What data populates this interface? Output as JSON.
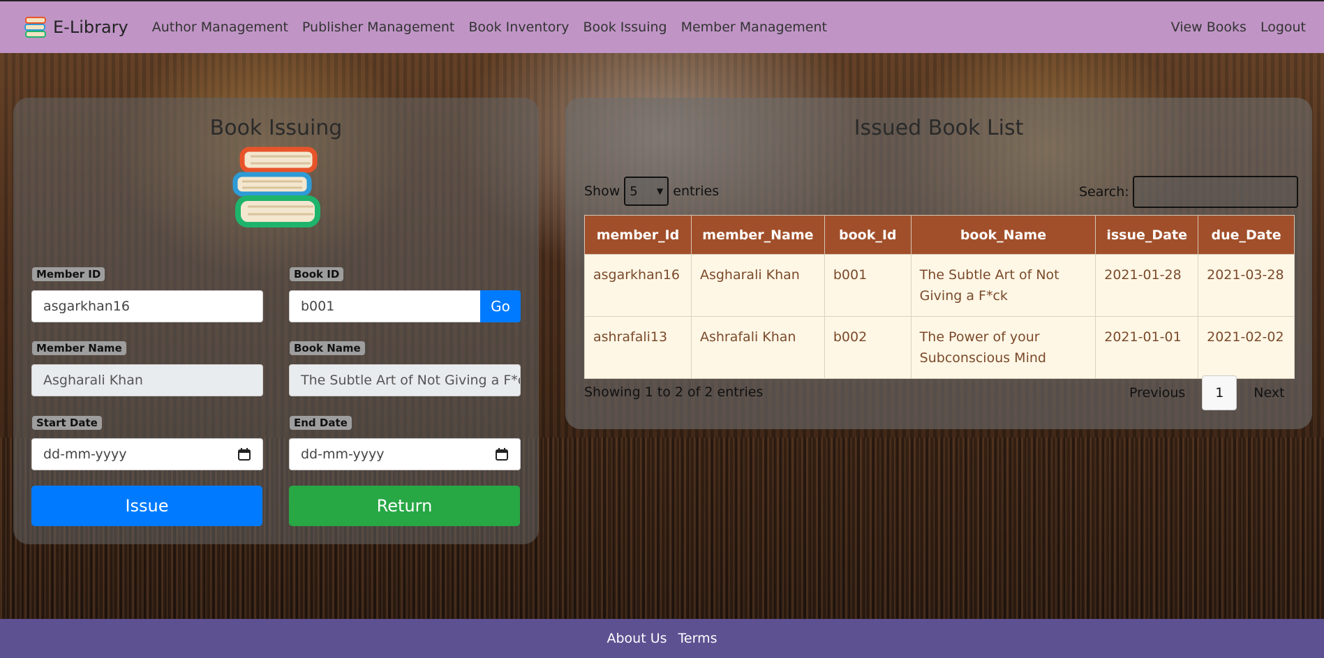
{
  "brand": {
    "name": "E-Library",
    "icon": "books-icon"
  },
  "nav": {
    "links": [
      "Author Management",
      "Publisher Management",
      "Book Inventory",
      "Book Issuing",
      "Member Management"
    ],
    "right": [
      "View Books",
      "Logout"
    ]
  },
  "issue_form": {
    "title": "Book Issuing",
    "member_id_label": "Member ID",
    "member_id_value": "asgarkhan16",
    "book_id_label": "Book ID",
    "book_id_value": "b001",
    "go_label": "Go",
    "member_name_label": "Member Name",
    "member_name_value": "Asgharali Khan",
    "book_name_label": "Book Name",
    "book_name_value": "The Subtle Art of Not Giving a F*c",
    "start_date_label": "Start Date",
    "start_date_placeholder": "dd-mm-yyyy",
    "end_date_label": "End Date",
    "end_date_placeholder": "dd-mm-yyyy",
    "issue_label": "Issue",
    "return_label": "Return"
  },
  "issued_list": {
    "title": "Issued Book List",
    "show_label": "Show",
    "page_size": "5",
    "entries_label": "entries",
    "search_label": "Search:",
    "columns": [
      "member_Id",
      "member_Name",
      "book_Id",
      "book_Name",
      "issue_Date",
      "due_Date"
    ],
    "rows": [
      [
        "asgarkhan16",
        "Asgharali Khan",
        "b001",
        "The Subtle Art of Not Giving a F*ck",
        "2021-01-28",
        "2021-03-28"
      ],
      [
        "ashrafali13",
        "Ashrafali Khan",
        "b002",
        "The Power of your Subconscious Mind",
        "2021-01-01",
        "2021-02-02"
      ]
    ],
    "info": "Showing 1 to 2 of 2 entries",
    "previous_label": "Previous",
    "current_page": "1",
    "next_label": "Next"
  },
  "footer": {
    "links": [
      "About Us",
      "Terms"
    ]
  },
  "colors": {
    "navbar": "#c095c6",
    "footer": "#5d5191",
    "primary": "#007bff",
    "success": "#28a745",
    "table_header": "#a14f2a",
    "table_row": "#fff7e6"
  }
}
